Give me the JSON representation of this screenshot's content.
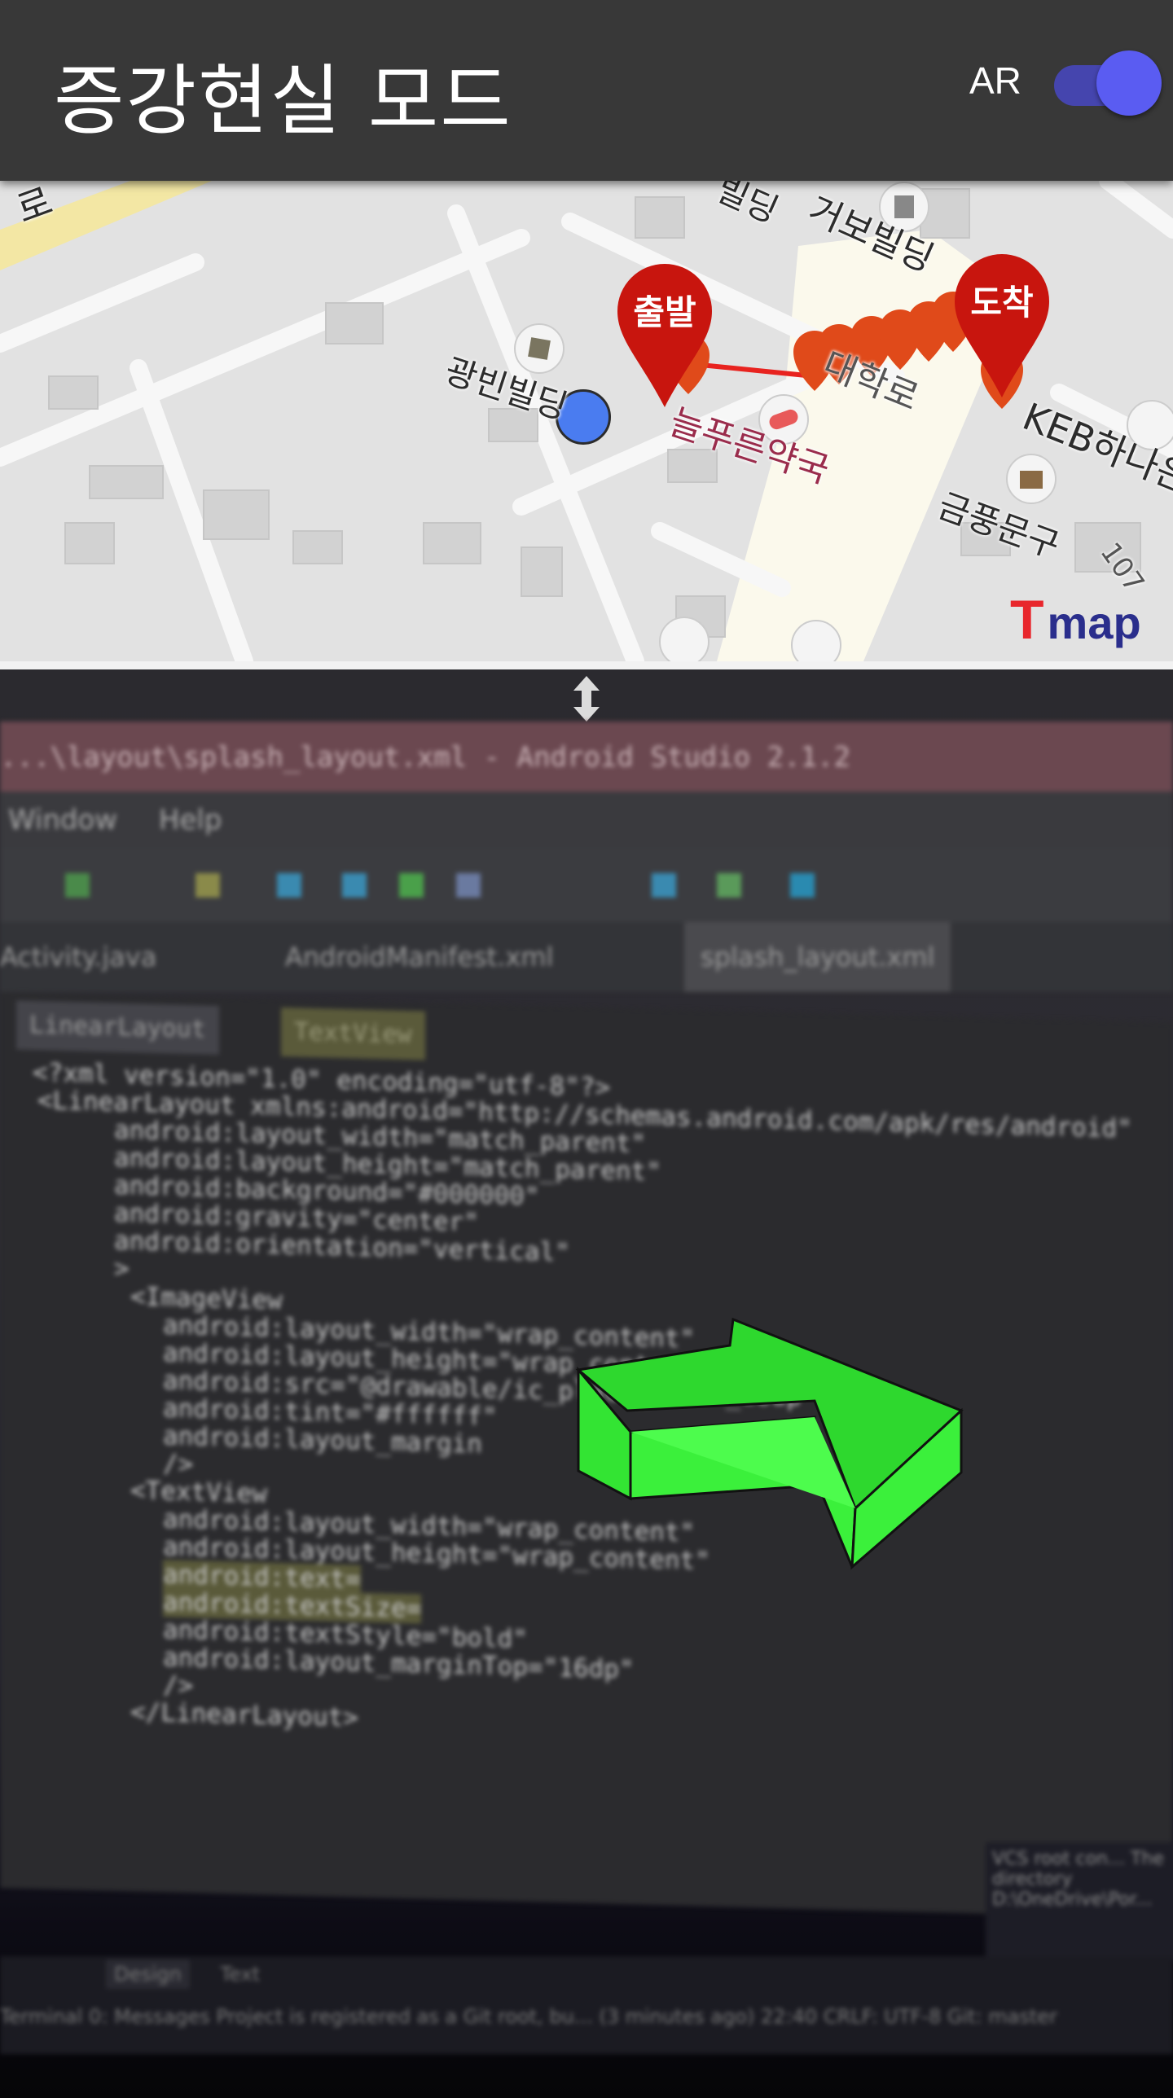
{
  "app_bar": {
    "title": "증강현실 모드",
    "ar_toggle_label": "AR",
    "ar_toggle_on": true,
    "accent_color": "#5a5cf2"
  },
  "map": {
    "start_marker_label": "출발",
    "end_marker_label": "도착",
    "marker_color": "#c8150e",
    "route_color": "#e8231f",
    "current_location_color": "#4a7cf0",
    "labels": {
      "building_1": "광빈빌딩",
      "pharmacy": "늘푸른약국",
      "building_2": "거보빌딩",
      "road": "대학로",
      "bank": "KEB하나은행",
      "stationery": "금풍문구",
      "building_number": "107",
      "road_top": "로",
      "top_partial": "빌딩"
    },
    "logo_text": "map"
  },
  "camera": {
    "drag_handle_icon": "vertical-resize-icon",
    "ar_arrow_color": "#3bff3b",
    "ide": {
      "window_title": "...\\layout\\splash_layout.xml - Android Studio 2.1.2",
      "menu_items": [
        "Window",
        "Help"
      ],
      "tabs": [
        "Activity.java",
        "AndroidManifest.xml",
        "splash_layout.xml"
      ],
      "breadcrumb_tabs": [
        "LinearLayout",
        "TextView"
      ],
      "code_lines": [
        "<?xml version=\"1.0\" encoding=\"utf-8\"?>",
        "<LinearLayout xmlns:android=\"http://schemas.android.com/apk/res/android\"",
        "    android:layout_width=\"match_parent\"",
        "    android:layout_height=\"match_parent\"",
        "    android:background=\"#000000\"",
        "    android:gravity=\"center\"",
        "    android:orientation=\"vertical\"",
        "    >",
        "    <ImageView",
        "        android:layout_width=\"wrap_content\"",
        "        android:layout_height=\"wrap_content\"",
        "        android:src=\"@drawable/ic_place_black_18dp\"",
        "        android:tint=\"#ffffff\"",
        "        android:layout_margin",
        "        />",
        "    <TextView",
        "        android:layout_width=\"wrap_content\"",
        "        android:layout_height=\"wrap_content\"",
        "        android:text=",
        "        android:textSize=",
        "        android:textStyle=\"bold\"",
        "        android:layout_marginTop=\"16dp\"",
        "        />",
        "</LinearLayout>"
      ],
      "bottom_tabs": [
        "Design",
        "Text"
      ],
      "status_text": "Terminal    0: Messages    Project is registered as a Git root, bu... (3 minutes ago)   22:40   CRLF:   UTF-8   Git: master",
      "popup_text": "VCS root con... The directory D:\\OneDrive\\Por..."
    }
  }
}
